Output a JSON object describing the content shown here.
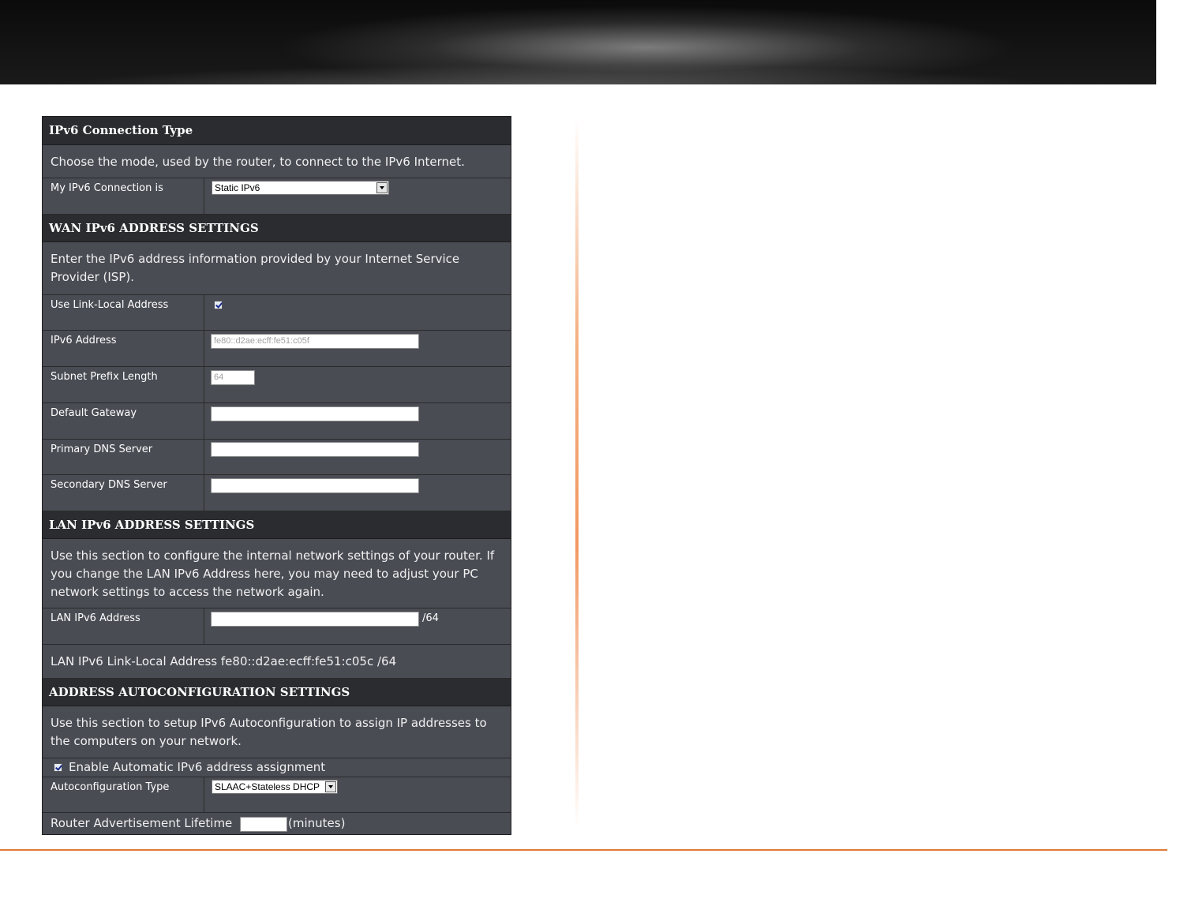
{
  "connection_type": {
    "title": "IPv6 Connection Type",
    "description": "Choose the mode, used by the router, to connect to the IPv6 Internet.",
    "mode_label": "My IPv6 Connection is",
    "mode_value": "Static IPv6"
  },
  "wan": {
    "title": "WAN IPv6 ADDRESS SETTINGS",
    "description": "Enter the IPv6 address information provided by your Internet Service Provider (ISP).",
    "use_link_local_label": "Use Link-Local Address",
    "use_link_local_checked": true,
    "ipv6_address_label": "IPv6 Address",
    "ipv6_address_value": "fe80::d2ae:ecff:fe51:c05f",
    "subnet_prefix_label": "Subnet Prefix Length",
    "subnet_prefix_value": "64",
    "default_gateway_label": "Default Gateway",
    "default_gateway_value": "",
    "primary_dns_label": "Primary DNS Server",
    "primary_dns_value": "",
    "secondary_dns_label": "Secondary DNS Server",
    "secondary_dns_value": ""
  },
  "lan": {
    "title": "LAN IPv6 ADDRESS SETTINGS",
    "description": "Use this section to configure the internal network settings of your router. If you change the LAN IPv6 Address here, you may need to adjust your PC network settings to access the network again.",
    "address_label": "LAN IPv6 Address",
    "address_value": "",
    "address_suffix": "/64",
    "link_local_text": "LAN IPv6 Link-Local Address fe80::d2ae:ecff:fe51:c05c /64"
  },
  "autoconfig": {
    "title": "ADDRESS AUTOCONFIGURATION SETTINGS",
    "description": "Use this section to setup IPv6 Autoconfiguration to assign IP addresses to the computers on your network.",
    "enable_label": "Enable Automatic IPv6 address assignment",
    "enable_checked": true,
    "type_label": "Autoconfiguration Type",
    "type_value": "SLAAC+Stateless DHCP",
    "lifetime_label": "Router Advertisement Lifetime",
    "lifetime_value": "",
    "lifetime_unit": "(minutes)"
  },
  "colors": {
    "accent_orange": "#e07b39",
    "panel_dark": "#2b2c30",
    "panel_row": "#4a4c54"
  }
}
